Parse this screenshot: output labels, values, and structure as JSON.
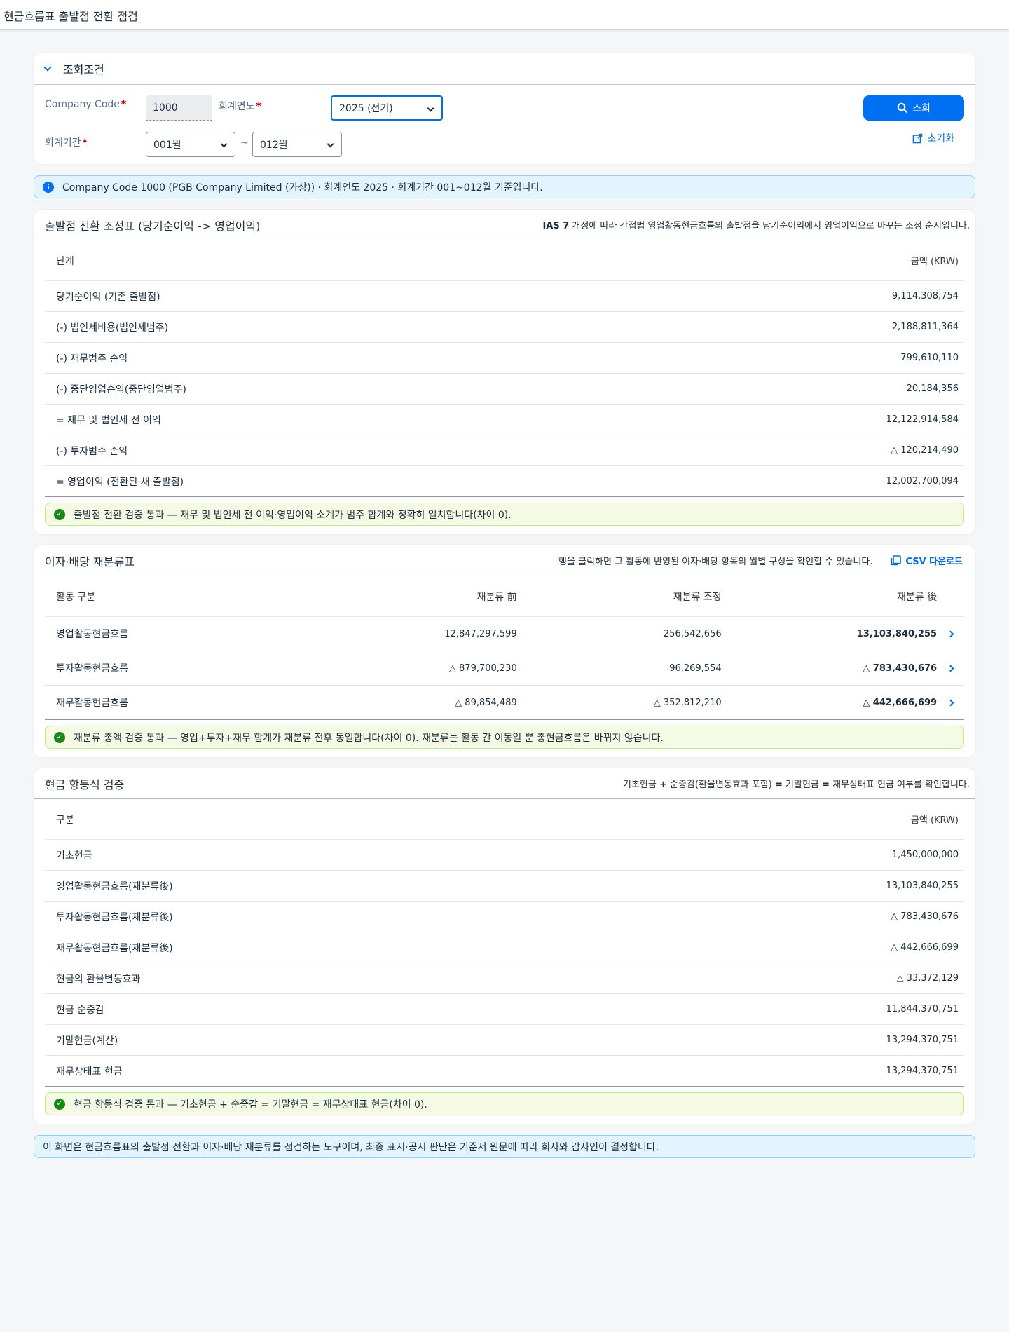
{
  "shell": {
    "title": "현금흐름표 출발점 전환 점검"
  },
  "filter": {
    "title": "조회조건",
    "company_code_label": "Company Code",
    "company_code_value": "1000",
    "fiscal_year_label": "회계연도",
    "fiscal_year_value": "2025 (전기)",
    "period_label": "회계기간",
    "period_from": "001월",
    "period_to": "012월",
    "tilde": "~",
    "required_mark": "*",
    "search_button": "조회",
    "reset_button": "초기화"
  },
  "info_strip": "Company Code 1000 (PGB Company Limited (가상)) · 회계연도 2025 · 회계기간 001~012월 기준입니다.",
  "start_point": {
    "title": "출발점 전환 조정표 (당기순이익 -> 영업이익)",
    "note_bold": "IAS 7",
    "note": " 개정에 따라 간접법 영업활동현금흐름의 출발점을 당기순이익에서 영업이익으로 바꾸는 조정 순서입니다.",
    "col_step": "단계",
    "col_amount": "금액 (KRW)",
    "rows": [
      {
        "step": "당기순이익 (기존 출발점)",
        "amount": "9,114,308,754"
      },
      {
        "step": "(-) 법인세비용(법인세범주)",
        "amount": "2,188,811,364"
      },
      {
        "step": "(-) 재무범주 손익",
        "amount": "799,610,110"
      },
      {
        "step": "(-) 중단영업손익(중단영업범주)",
        "amount": "20,184,356"
      },
      {
        "step": "= 재무 및 법인세 전 이익",
        "amount": "12,122,914,584"
      },
      {
        "step": "(-) 투자범주 손익",
        "amount": "△ 120,214,490"
      },
      {
        "step": "= 영업이익 (전환된 새 출발점)",
        "amount": "12,002,700,094"
      }
    ],
    "check": "출발점 전환 검증 통과 — 재무 및 법인세 전 이익·영업이익 소계가 범주 합계와 정확히 일치합니다(차이 0)."
  },
  "reclass": {
    "title": "이자·배당 재분류표",
    "note": "행을 클릭하면 그 활동에 반영된 이자·배당 항목의 월별 구성을 확인할 수 있습니다.",
    "csv_label": "CSV 다운로드",
    "col_activity": "활동 구분",
    "col_before": "재분류 前",
    "col_adjust": "재분류 조정",
    "col_after": "재분류 後",
    "rows": [
      {
        "activity": "영업활동현금흐름",
        "before": "12,847,297,599",
        "adjust": "256,542,656",
        "after": "13,103,840,255"
      },
      {
        "activity": "투자활동현금흐름",
        "before": "△ 879,700,230",
        "adjust": "96,269,554",
        "after": "△ 783,430,676"
      },
      {
        "activity": "재무활동현금흐름",
        "before": "△ 89,854,489",
        "adjust": "△ 352,812,210",
        "after": "△ 442,666,699"
      }
    ],
    "check": "재분류 총액 검증 통과 — 영업+투자+재무 합계가 재분류 전후 동일합니다(차이 0). 재분류는 활동 간 이동일 뿐 총현금흐름은 바뀌지 않습니다."
  },
  "identity": {
    "title": "현금 항등식 검증",
    "note_a": "기초현금 ",
    "note_plus": "+",
    "note_b": " 순증감(환율변동효과 포함) ",
    "note_eq1": "=",
    "note_c": " 기말현금 ",
    "note_eq2": "=",
    "note_d": " 재무상태표 현금 여부를 확인합니다.",
    "col_item": "구분",
    "col_amount": "금액 (KRW)",
    "rows": [
      {
        "item": "기초현금",
        "amount": "1,450,000,000"
      },
      {
        "item": "영업활동현금흐름(재분류後)",
        "amount": "13,103,840,255"
      },
      {
        "item": "투자활동현금흐름(재분류後)",
        "amount": "△ 783,430,676"
      },
      {
        "item": "재무활동현금흐름(재분류後)",
        "amount": "△ 442,666,699"
      },
      {
        "item": "현금의 환율변동효과",
        "amount": "△ 33,372,129"
      },
      {
        "item": "현금 순증감",
        "amount": "11,844,370,751"
      },
      {
        "item": "기말현금(계산)",
        "amount": "13,294,370,751"
      },
      {
        "item": "재무상태표 현금",
        "amount": "13,294,370,751"
      }
    ],
    "check": "현금 항등식 검증 통과 — 기초현금 + 순증감 = 기말현금 = 재무상태표 현금(차이 0)."
  },
  "footer_note": "이 화면은 현금흐름표의 출발점 전환과 이자·배당 재분류를 점검하는 도구이며, 최종 표시·공시 판단은 기준서 원문에 따라 회사와 감사인이 결정합니다."
}
